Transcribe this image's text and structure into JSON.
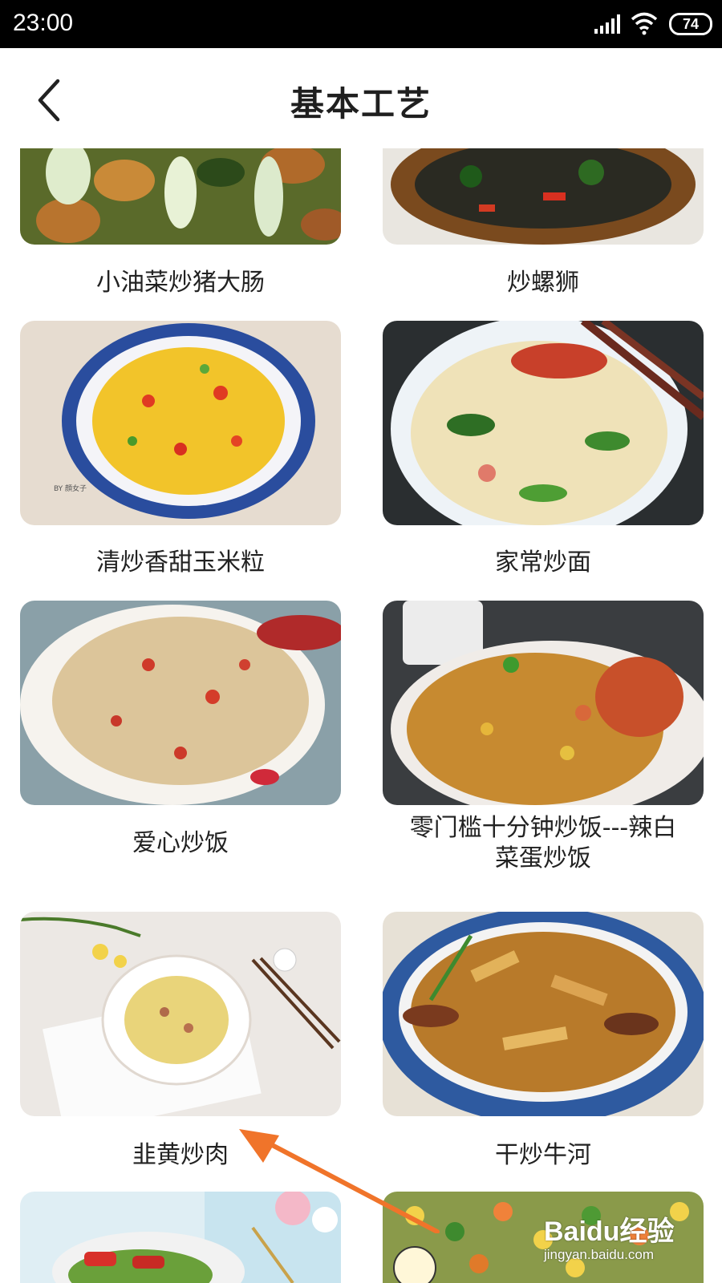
{
  "status_bar": {
    "time": "23:00",
    "battery": "74"
  },
  "header": {
    "title": "基本工艺"
  },
  "items": [
    {
      "title": "小油菜炒猪大肠"
    },
    {
      "title": "炒螺狮"
    },
    {
      "title": "清炒香甜玉米粒"
    },
    {
      "title": "家常炒面"
    },
    {
      "title": "爱心炒饭"
    },
    {
      "title": "零门槛十分钟炒饭---辣白\n菜蛋炒饭"
    },
    {
      "title": "韭黄炒肉"
    },
    {
      "title": "干炒牛河"
    }
  ],
  "image_overlays": {
    "corn_photo_caption": "BY 顔女子"
  },
  "watermark": {
    "brand": "Baidu经验",
    "url": "jingyan.baidu.com"
  },
  "colors": {
    "arrow": "#f0742a",
    "status_bar": "#000000",
    "title_text": "#1f1f1f"
  }
}
